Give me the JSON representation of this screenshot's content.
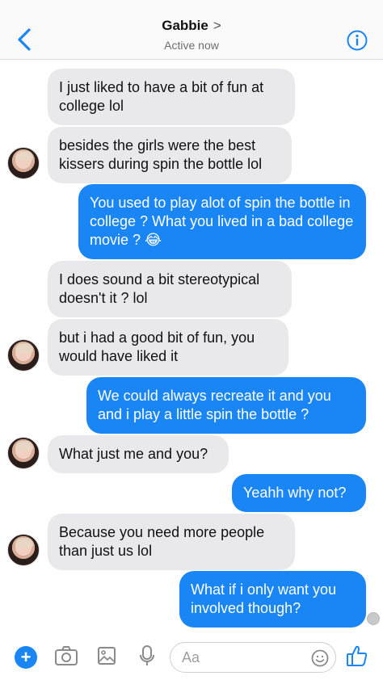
{
  "header": {
    "title": "Gabbie",
    "chevron": ">",
    "status": "Active now",
    "back_icon": "chevron-left-icon",
    "info_icon": "info-icon",
    "accent": "#1a86f5"
  },
  "messages": [
    {
      "from": "them",
      "text": "I just liked to have a bit of fun at college lol"
    },
    {
      "from": "them",
      "text": "besides the girls were the best kissers during spin the bottle lol"
    },
    {
      "from": "me",
      "text": "You used to play alot of spin the bottle in college ? What you lived in a bad college movie ? 😂"
    },
    {
      "from": "them",
      "text": "I does sound a bit stereotypical doesn't it ? lol"
    },
    {
      "from": "them",
      "text": "but i had a good bit of fun, you would have liked it"
    },
    {
      "from": "me",
      "text": "We could always recreate it and you and i play a little spin the bottle ?"
    },
    {
      "from": "them",
      "text": "What just me and you?"
    },
    {
      "from": "me",
      "text": "Yeahh why not?"
    },
    {
      "from": "them",
      "text": "Because you need more people than just us lol"
    },
    {
      "from": "me",
      "text": "What if i only want you involved though?"
    }
  ],
  "composer": {
    "placeholder": "Aa",
    "icons": [
      "plus-icon",
      "camera-icon",
      "image-icon",
      "microphone-icon",
      "emoji-icon",
      "thumbs-up-icon"
    ]
  },
  "colors": {
    "outgoing_bubble": "#1a86f5",
    "incoming_bubble": "#e9e9eb"
  }
}
